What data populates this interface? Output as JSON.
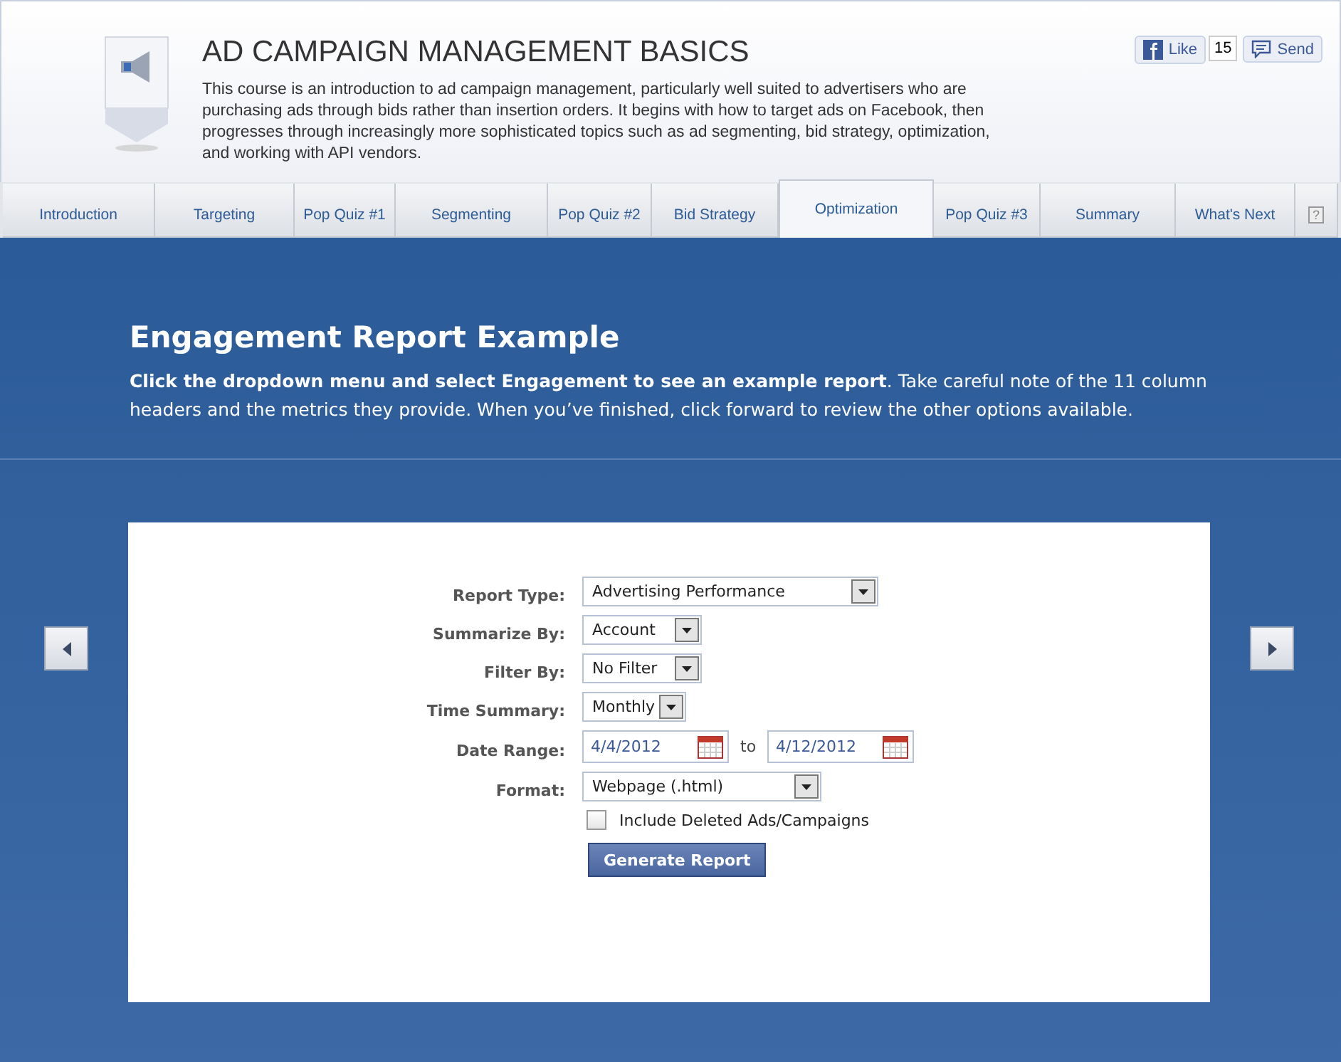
{
  "header": {
    "title": "AD CAMPAIGN MANAGEMENT BASICS",
    "description": "This course is an introduction to ad campaign management, particularly well suited to advertisers who are purchasing ads through bids rather than insertion orders. It begins with how to target ads on Facebook, then progresses through increasingly more sophisticated topics such as ad segmenting, bid strategy, optimization, and working with API vendors.",
    "like_label": "Like",
    "like_count": "15",
    "send_label": "Send"
  },
  "tabs": [
    {
      "label": "Introduction",
      "selected": false,
      "kind": "page"
    },
    {
      "label": "Targeting",
      "selected": false,
      "kind": "page"
    },
    {
      "label": "Pop Quiz #1",
      "selected": false,
      "kind": "page"
    },
    {
      "label": "Segmenting",
      "selected": false,
      "kind": "page"
    },
    {
      "label": "Pop Quiz #2",
      "selected": false,
      "kind": "page"
    },
    {
      "label": "Bid Strategy",
      "selected": false,
      "kind": "page"
    },
    {
      "label": "Optimization",
      "selected": true,
      "kind": "page"
    },
    {
      "label": "Pop Quiz #3",
      "selected": false,
      "kind": "page"
    },
    {
      "label": "Summary",
      "selected": false,
      "kind": "page"
    },
    {
      "label": "What's Next",
      "selected": false,
      "kind": "page"
    },
    {
      "label": "?",
      "selected": false,
      "kind": "help"
    }
  ],
  "lesson": {
    "title": "Engagement Report Example",
    "instruction": "**Click the dropdown menu and select Engagement to see an example report**. Take careful note of the 11 column headers and the metrics they provide. When you’ve finished, click forward to review the other options available."
  },
  "form": {
    "fields": [
      {
        "label": "Report Type:",
        "kind": "select",
        "value": "Advertising Performance"
      },
      {
        "label": "Summarize By:",
        "kind": "select",
        "value": "Account"
      },
      {
        "label": "Filter By:",
        "kind": "select",
        "value": "No Filter"
      },
      {
        "label": "Time Summary:",
        "kind": "select",
        "value": "Monthly"
      },
      {
        "label": "Date Range:",
        "kind": "date_range",
        "from": "4/4/2012",
        "separator": "to",
        "to": "4/12/2012"
      },
      {
        "label": "Format:",
        "kind": "select",
        "value": "Webpage (.html)"
      }
    ],
    "checkbox": {
      "label": "Include Deleted Ads/Campaigns",
      "checked": false
    },
    "button": "Generate Report"
  }
}
